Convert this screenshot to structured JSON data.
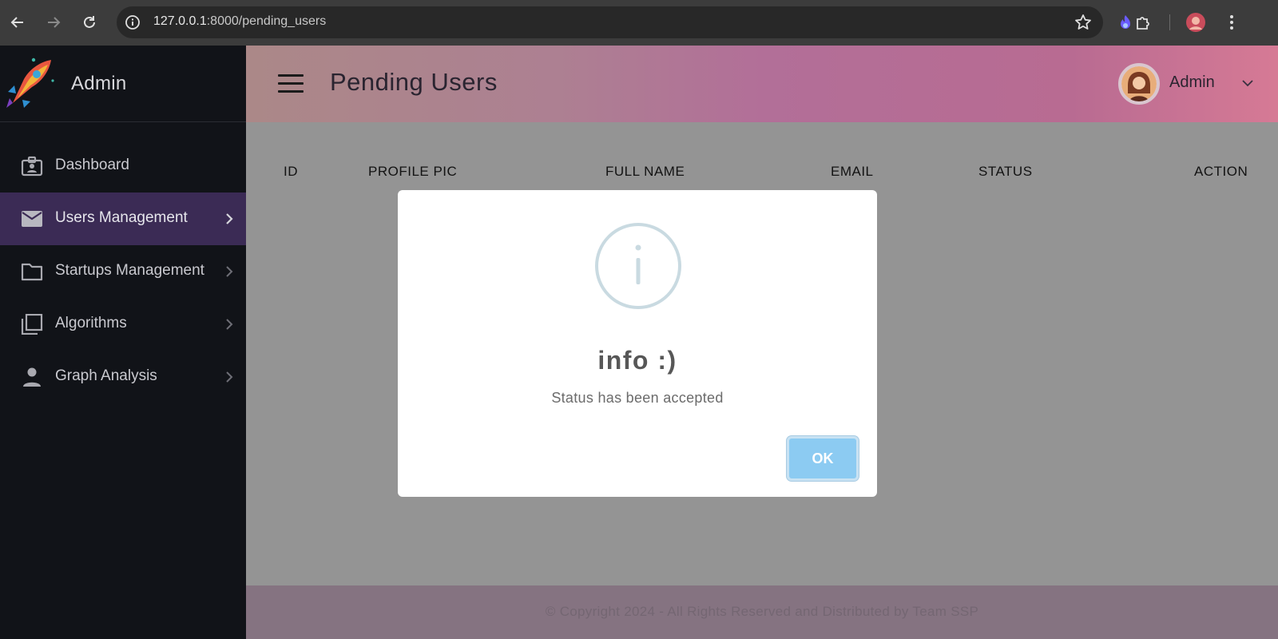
{
  "browser": {
    "url_host": "127.0.0.1",
    "url_path": ":8000/pending_users"
  },
  "sidebar": {
    "brand_title": "Admin",
    "items": [
      {
        "label": "Dashboard",
        "icon": "badge-icon"
      },
      {
        "label": "Users Management",
        "icon": "mail-icon"
      },
      {
        "label": "Startups Management",
        "icon": "folder-icon"
      },
      {
        "label": "Algorithms",
        "icon": "copy-icon"
      },
      {
        "label": "Graph Analysis",
        "icon": "person-icon"
      }
    ],
    "active_item": "Users Management"
  },
  "header": {
    "title": "Pending Users",
    "user_name": "Admin"
  },
  "table": {
    "columns": [
      "ID",
      "PROFILE PIC",
      "FULL NAME",
      "EMAIL",
      "STATUS",
      "ACTION"
    ]
  },
  "footer": {
    "copyright": "© Copyright 2024 - All Rights Reserved and Distributed by Team SSP"
  },
  "dialog": {
    "title": "info :)",
    "message": "Status has been accepted",
    "ok_label": "OK"
  },
  "colors": {
    "sidebar_bg": "#111318",
    "active_item_bg": "#3b2b55",
    "ok_button": "#8ccbf2"
  }
}
